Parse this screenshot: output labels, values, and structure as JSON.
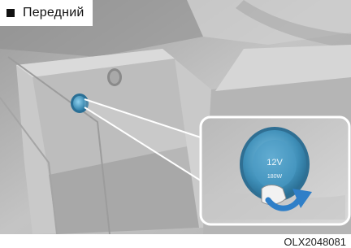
{
  "section_label": {
    "marker": "black-square-icon",
    "text": "Передний"
  },
  "figure_code": "OLX2048081",
  "socket": {
    "voltage_label": "12V",
    "power_label": "180W"
  },
  "colors": {
    "socket_blue": "#3f8fb8",
    "arrow_blue": "#2f7fc8"
  }
}
